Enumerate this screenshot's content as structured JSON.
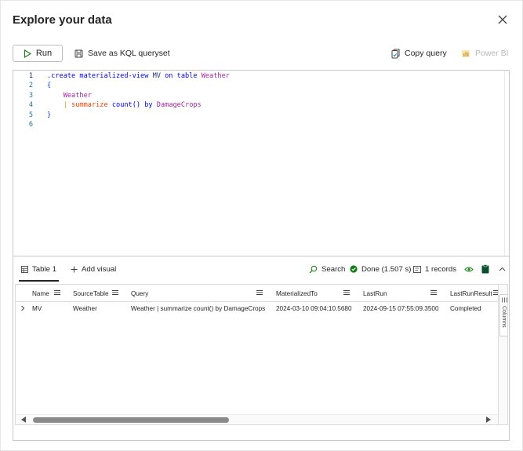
{
  "dialog": {
    "title": "Explore your data"
  },
  "toolbar": {
    "run_label": "Run",
    "save_label": "Save as KQL queryset",
    "copy_label": "Copy query",
    "powerbi_label": "Power BI"
  },
  "editor": {
    "line_numbers": [
      "1",
      "2",
      "3",
      "4",
      "5",
      "6"
    ],
    "line1": {
      "create": ".create",
      "mv_kw": "materialized-view",
      "mv_name": "MV",
      "on": "on",
      "table": "table",
      "source": "Weather"
    },
    "line2": {
      "brace": "{"
    },
    "line3": {
      "table": "Weather"
    },
    "line4": {
      "pipe": "|",
      "op": "summarize",
      "fn": "count()",
      "by": "by",
      "col": "DamageCrops"
    },
    "line5": {
      "brace": "}"
    }
  },
  "results": {
    "tab_table": "Table 1",
    "tab_add": "Add visual",
    "search_label": "Search",
    "status": "Done (1.507 s)",
    "records": "1 records",
    "columns_side_label": "Columns",
    "headers": [
      "Name",
      "SourceTable",
      "Query",
      "MaterializedTo",
      "LastRun",
      "LastRunResult"
    ],
    "rows": [
      [
        "MV",
        "Weather",
        "Weather | summarize count() by DamageCrops",
        "2024-03-10 09:04:10.5680",
        "2024-09-15 07:55:09.3500",
        "Completed"
      ]
    ]
  },
  "colors": {
    "done": "#107c10",
    "keyword": "#0000ff",
    "table": "#a626a4",
    "operator": "#ee4400",
    "linenum": "#237893"
  }
}
